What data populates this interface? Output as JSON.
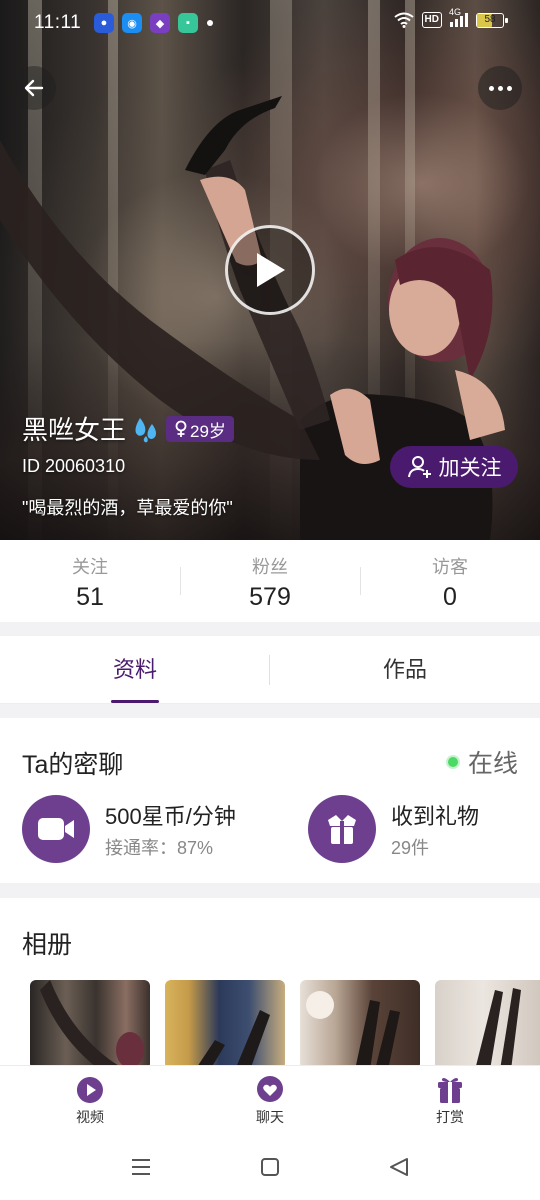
{
  "status_bar": {
    "time": "11:11",
    "network": "4G",
    "hd": "HD",
    "battery": "58"
  },
  "profile": {
    "name": "黑咝女王",
    "age_badge": "29岁",
    "id": "ID 20060310",
    "signature": "\"喝最烈的酒，草最爱的你\"",
    "follow_label": "加关注"
  },
  "stats": [
    {
      "label": "关注",
      "value": "51"
    },
    {
      "label": "粉丝",
      "value": "579"
    },
    {
      "label": "访客",
      "value": "0"
    }
  ],
  "tabs": [
    {
      "label": "资料",
      "active": true
    },
    {
      "label": "作品",
      "active": false
    }
  ],
  "chat": {
    "title": "Ta的密聊",
    "status": "在线",
    "price": "500星币/分钟",
    "connect_rate": "接通率：87%",
    "gifts_title": "收到礼物",
    "gifts_count": "29件"
  },
  "album": {
    "title": "相册"
  },
  "bottom_nav": [
    {
      "label": "视频",
      "icon": "video-play-icon"
    },
    {
      "label": "聊天",
      "icon": "chat-heart-icon"
    },
    {
      "label": "打赏",
      "icon": "gift-icon"
    }
  ],
  "colors": {
    "accent": "#4a1a6e",
    "feature_icon_bg": "#6e3f8f",
    "online": "#4cd964"
  }
}
